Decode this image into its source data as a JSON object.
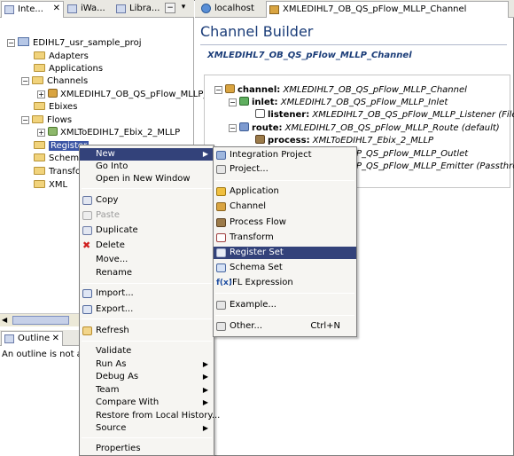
{
  "left_tabs": [
    {
      "label": "Inte..."
    },
    {
      "label": "iWa..."
    },
    {
      "label": "Libra..."
    }
  ],
  "tree": {
    "project": "EDIHL7_usr_sample_proj",
    "adapters": "Adapters",
    "applications": "Applications",
    "channels": "Channels",
    "channel_item": "XMLEDIHL7_OB_QS_pFlow_MLLP_",
    "ebixes": "Ebixes",
    "flows": "Flows",
    "flow_item": "XMLToEDIHL7_Ebix_2_MLLP",
    "register": "Register",
    "schemas": "Schemas",
    "transforms": "Transfor",
    "xml": "XML"
  },
  "outline": {
    "label": "Outline",
    "message": "An outline is not avai"
  },
  "editor": {
    "tabs": [
      {
        "label": "localhost"
      },
      {
        "label": "XMLEDIHL7_OB_QS_pFlow_MLLP_Channel"
      }
    ],
    "title": "Channel Builder",
    "subtitle": "XMLEDIHL7_OB_QS_pFlow_MLLP_Channel",
    "diagram": {
      "channel_key": "channel:",
      "channel_val": "XMLEDIHL7_OB_QS_pFlow_MLLP_Channel",
      "inlet_key": "inlet:",
      "inlet_val": "XMLEDIHL7_OB_QS_pFlow_MLLP_Inlet",
      "listener_key": "listener:",
      "listener_val": "XMLEDIHL7_OB_QS_pFlow_MLLP_Listener (File)",
      "route_key": "route:",
      "route_val": "XMLEDIHL7_OB_QS_pFlow_MLLP_Route (default)",
      "process_key": "process:",
      "process_val": "XMLToEDIHL7_Ebix_2_MLLP",
      "outlet_tail": "P_QS_pFlow_MLLP_Outlet",
      "emitter_tail": "P_QS_pFlow_MLLP_Emitter (Passthrough)"
    }
  },
  "context_menu": {
    "items": [
      {
        "label": "New"
      },
      {
        "label": "Go Into"
      },
      {
        "label": "Open in New Window"
      },
      {
        "label": "Copy"
      },
      {
        "label": "Paste"
      },
      {
        "label": "Duplicate"
      },
      {
        "label": "Delete"
      },
      {
        "label": "Move..."
      },
      {
        "label": "Rename"
      },
      {
        "label": "Import..."
      },
      {
        "label": "Export..."
      },
      {
        "label": "Refresh"
      },
      {
        "label": "Validate"
      },
      {
        "label": "Run As"
      },
      {
        "label": "Debug As"
      },
      {
        "label": "Team"
      },
      {
        "label": "Compare With"
      },
      {
        "label": "Restore from Local History..."
      },
      {
        "label": "Source"
      },
      {
        "label": "Properties"
      }
    ]
  },
  "submenu": {
    "items": [
      {
        "label": "Integration Project"
      },
      {
        "label": "Project..."
      },
      {
        "label": "Application"
      },
      {
        "label": "Channel"
      },
      {
        "label": "Process Flow"
      },
      {
        "label": "Transform"
      },
      {
        "label": "Register Set"
      },
      {
        "label": "Schema Set"
      },
      {
        "label": "IFL Expression"
      },
      {
        "label": "Example..."
      },
      {
        "label": "Other..."
      }
    ],
    "other_shortcut": "Ctrl+N"
  },
  "colors": {
    "selection": "#33427a",
    "title": "#1a3c78",
    "folder": "#f1d37c"
  }
}
